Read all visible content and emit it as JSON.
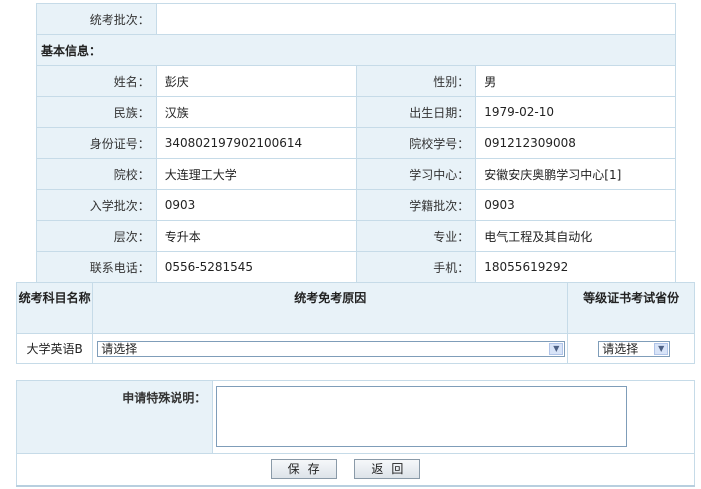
{
  "basic": {
    "exam_batch_label": "统考批次：",
    "exam_batch_value": "",
    "section_title": "基本信息：",
    "rows": [
      {
        "l1": "姓名：",
        "v1": "彭庆",
        "l2": "性别：",
        "v2": "男"
      },
      {
        "l1": "民族：",
        "v1": "汉族",
        "l2": "出生日期：",
        "v2": "1979-02-10"
      },
      {
        "l1": "身份证号：",
        "v1": "340802197902100614",
        "l2": "院校学号：",
        "v2": "091212309008"
      },
      {
        "l1": "院校：",
        "v1": "大连理工大学",
        "l2": "学习中心：",
        "v2": "安徽安庆奥鹏学习中心[1]"
      },
      {
        "l1": "入学批次：",
        "v1": "0903",
        "l2": "学籍批次：",
        "v2": "0903"
      },
      {
        "l1": "层次：",
        "v1": "专升本",
        "l2": "专业：",
        "v2": "电气工程及其自动化"
      },
      {
        "l1": "联系电话：",
        "v1": "0556-5281545",
        "l2": "手机：",
        "v2": "18055619292"
      }
    ]
  },
  "exam": {
    "col_subject": "统考科目名称",
    "col_reason": "统考免考原因",
    "col_province": "等级证书考试省份",
    "subject": "大学英语B",
    "reason_select": "请选择",
    "province_select": "请选择"
  },
  "remark": {
    "label": "申请特殊说明：",
    "value": ""
  },
  "buttons": {
    "save": "保存",
    "back": "返回"
  },
  "colors": {
    "label_bg": "#e8f2f8",
    "border": "#c6dbe8"
  }
}
